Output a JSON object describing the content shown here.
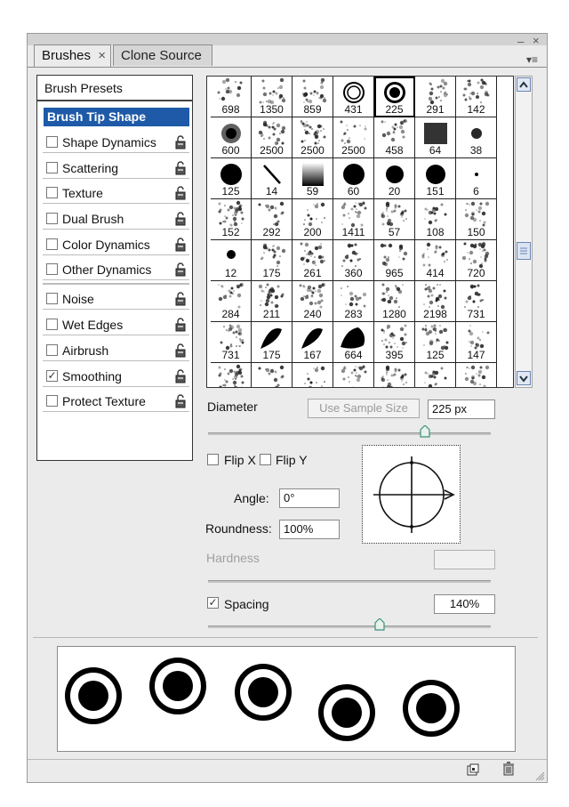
{
  "tabs": [
    {
      "label": "Brushes",
      "close": "×"
    },
    {
      "label": "Clone Source"
    }
  ],
  "window_controls": {
    "minimize": "–",
    "close": "×",
    "menu": "▾≡"
  },
  "sidebar": {
    "presets_label": "Brush Presets",
    "selected_label": "Brush Tip Shape",
    "options_group1": [
      {
        "label": "Shape Dynamics",
        "checked": false
      },
      {
        "label": "Scattering",
        "checked": false
      },
      {
        "label": "Texture",
        "checked": false
      },
      {
        "label": "Dual Brush",
        "checked": false
      },
      {
        "label": "Color Dynamics",
        "checked": false
      },
      {
        "label": "Other Dynamics",
        "checked": false
      }
    ],
    "options_group2": [
      {
        "label": "Noise",
        "checked": false
      },
      {
        "label": "Wet Edges",
        "checked": false
      },
      {
        "label": "Airbrush",
        "checked": false
      },
      {
        "label": "Smoothing",
        "checked": true
      },
      {
        "label": "Protect Texture",
        "checked": false
      }
    ],
    "check_mark": "✓"
  },
  "brush_grid": {
    "rows": [
      [
        "698",
        "1350",
        "859",
        "431",
        "225",
        "291",
        "142"
      ],
      [
        "600",
        "2500",
        "2500",
        "2500",
        "458",
        "64",
        "38"
      ],
      [
        "125",
        "14",
        "59",
        "60",
        "20",
        "151",
        "6"
      ],
      [
        "152",
        "292",
        "200",
        "1411",
        "57",
        "108",
        "150"
      ],
      [
        "12",
        "175",
        "261",
        "360",
        "965",
        "414",
        "720"
      ],
      [
        "284",
        "211",
        "240",
        "283",
        "1280",
        "2198",
        "731"
      ],
      [
        "731",
        "175",
        "167",
        "664",
        "395",
        "125",
        "147"
      ]
    ],
    "selected": "225"
  },
  "controls": {
    "diameter_label": "Diameter",
    "use_sample_size_label": "Use Sample Size",
    "diameter_value": "225 px",
    "flip_x_label": "Flip X",
    "flip_y_label": "Flip Y",
    "angle_label": "Angle:",
    "angle_value": "0°",
    "roundness_label": "Roundness:",
    "roundness_value": "100%",
    "hardness_label": "Hardness",
    "hardness_value": "",
    "spacing_label": "Spacing",
    "spacing_checked": true,
    "spacing_value": "140%",
    "check_mark": "✓"
  },
  "bottom_icons": [
    "new-brush-icon",
    "trash-icon"
  ],
  "colors": {
    "selection": "#1e5aa8",
    "panel": "#ebebeb",
    "accent_knob": "#3d8f7a"
  }
}
